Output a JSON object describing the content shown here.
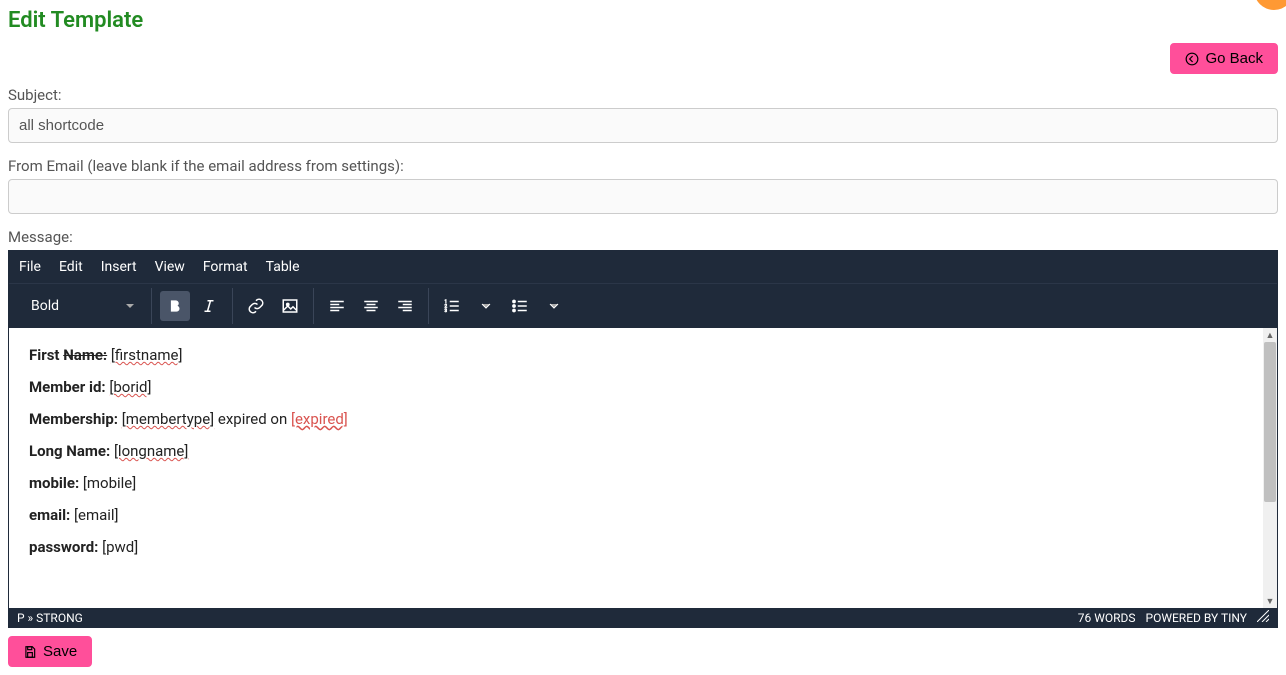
{
  "page": {
    "title": "Edit Template",
    "go_back": "Go Back",
    "save": "Save"
  },
  "form": {
    "subject_label": "Subject:",
    "subject_value": "all shortcode",
    "from_label": "From Email (leave blank if the email address from settings):",
    "from_value": "",
    "message_label": "Message:"
  },
  "editor": {
    "menus": {
      "file": "File",
      "edit": "Edit",
      "insert": "Insert",
      "view": "View",
      "format": "Format",
      "table": "Table"
    },
    "font_selector": "Bold",
    "status_path": "P » STRONG",
    "word_count": "76 WORDS",
    "powered": "POWERED BY TINY"
  },
  "content": {
    "lines": [
      {
        "label_pre": "First ",
        "label_strike": "Name:",
        "sc": "[firstname]"
      },
      {
        "label": "Member id:",
        "sc": "[borid]"
      },
      {
        "label": "Membership:",
        "sc": "[membertype]",
        "mid": " expired on ",
        "sc2": "[expired]"
      },
      {
        "label": "Long Name:",
        "sc": "[longname]"
      },
      {
        "label": "mobile:",
        "plain": " [mobile]"
      },
      {
        "label": "email:",
        "plain": " [email]"
      },
      {
        "label": "password:",
        "plain": " [pwd]"
      }
    ]
  }
}
